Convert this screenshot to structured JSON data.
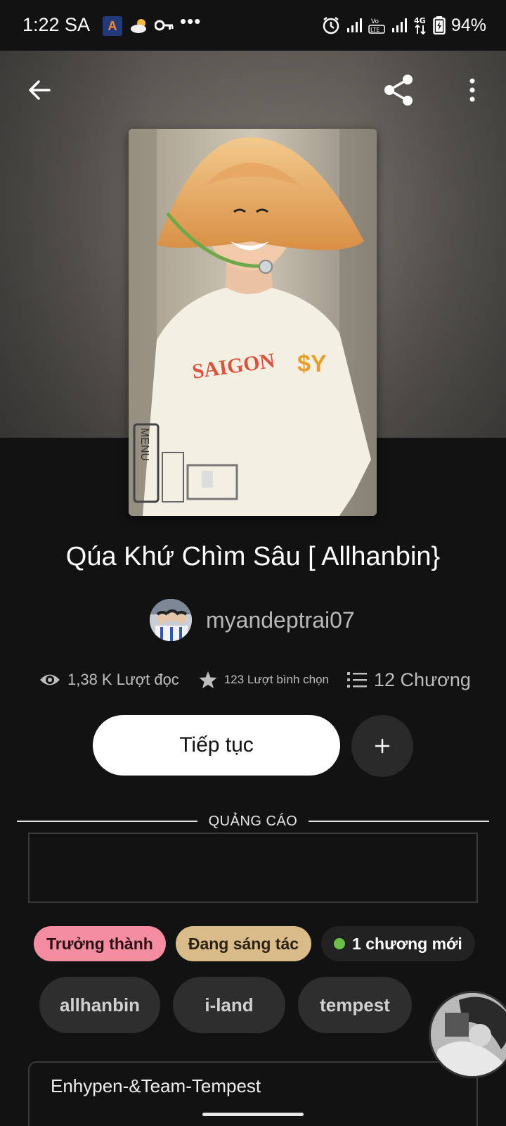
{
  "status_bar": {
    "time": "1:22 SA",
    "battery": "94%",
    "network": "4G",
    "app_icon_letter": "A"
  },
  "story": {
    "title": "Qúa Khứ Chìm Sâu [ Allhanbin}",
    "author": "myandeptrai07",
    "reads": "1,38 K Lượt đọc",
    "votes": "123 Lượt bình chọn",
    "parts": "12 Chương"
  },
  "actions": {
    "continue_label": "Tiếp tục"
  },
  "ad": {
    "label": "QUẢNG CÁO"
  },
  "badges": {
    "mature": "Trưởng thành",
    "ongoing": "Đang sáng tác",
    "new_chapter": "1 chương mới"
  },
  "tags": [
    "allhanbin",
    "i-land",
    "tempest"
  ],
  "description": {
    "first_line": "Enhypen-&Team-Tempest"
  },
  "colors": {
    "badge_mature": "#f48da0",
    "badge_ongoing": "#d9bb8a",
    "new_dot": "#6cc04a"
  },
  "icons": {
    "back": "arrow-left-icon",
    "share": "share-icon",
    "more": "more-vertical-icon",
    "reads": "eye-icon",
    "votes": "star-icon",
    "parts": "list-icon",
    "add": "plus-icon"
  }
}
